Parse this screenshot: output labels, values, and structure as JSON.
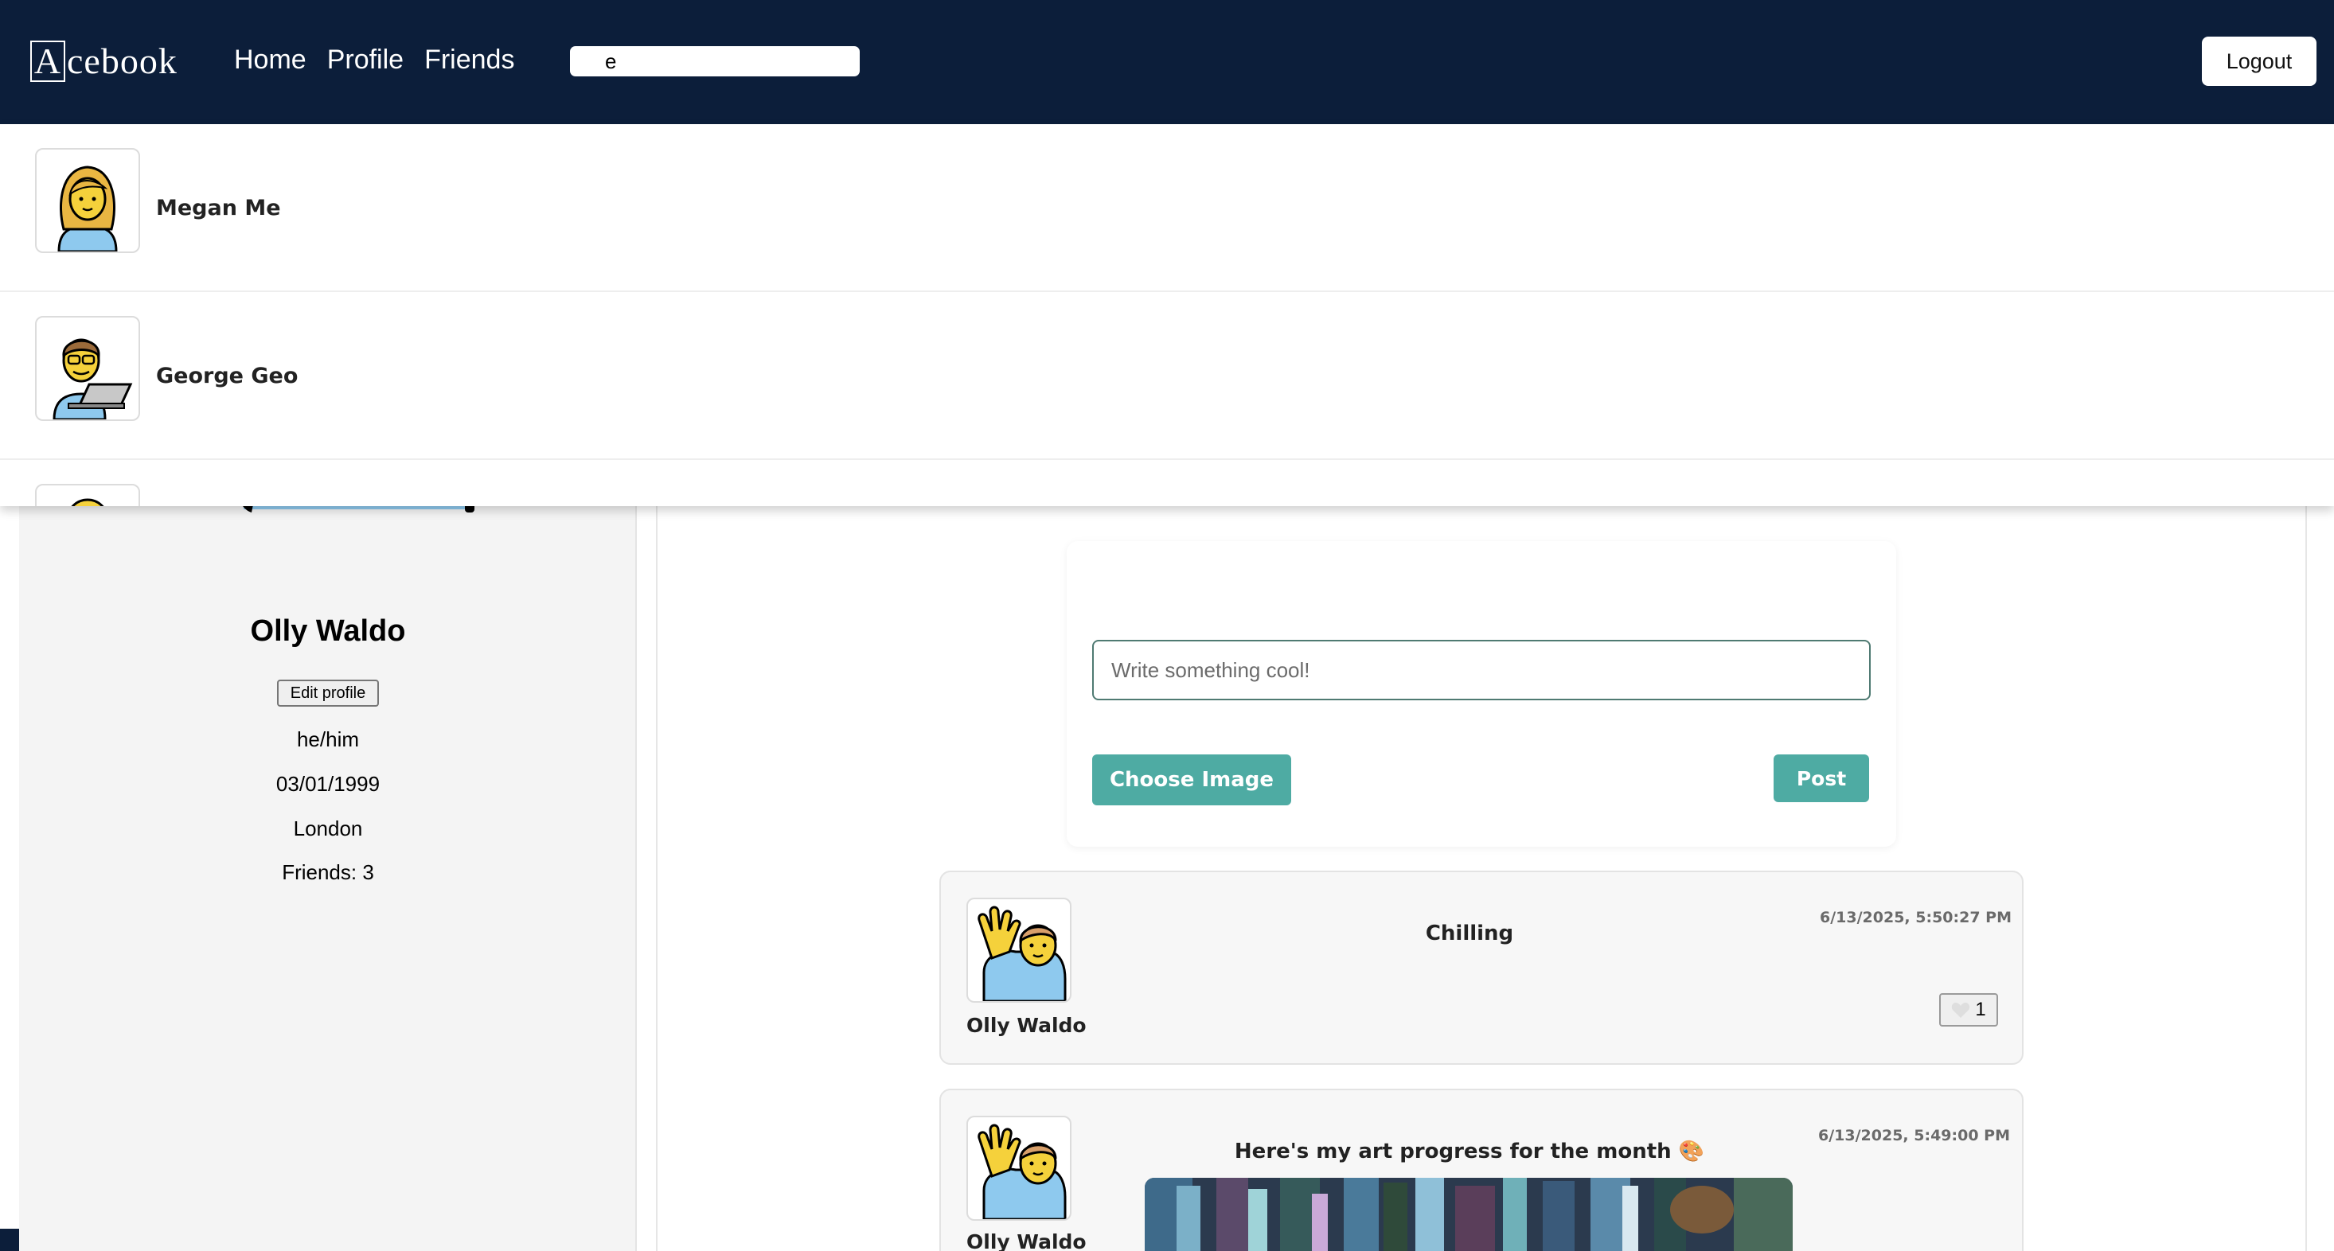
{
  "navbar": {
    "brand_initial": "A",
    "brand_rest": "cebook",
    "links": [
      "Home",
      "Profile",
      "Friends"
    ],
    "search_value": "e",
    "logout_label": "Logout"
  },
  "search_results": [
    {
      "name": "Megan Me",
      "avatar": "woman-avatar-icon"
    },
    {
      "name": "George Geo",
      "avatar": "man-technologist-avatar-icon"
    },
    {
      "name": "",
      "avatar": "partial-avatar-icon"
    }
  ],
  "profile": {
    "name": "Olly Waldo",
    "edit_label": "Edit profile",
    "pronouns": "he/him",
    "dob": "03/01/1999",
    "location": "London",
    "friends": "Friends: 3"
  },
  "composer": {
    "placeholder": "Write something cool!",
    "choose_image_label": "Choose Image",
    "post_label": "Post"
  },
  "posts": [
    {
      "author": "Olly Waldo",
      "text": "Chilling",
      "timestamp": "6/13/2025, 5:50:27 PM",
      "likes": "1",
      "avatar": "person-raising-hand-icon"
    },
    {
      "author": "Olly Waldo",
      "text": "Here's my art progress for the month 🎨",
      "timestamp": "6/13/2025, 5:49:00 PM",
      "likes": "",
      "avatar": "person-raising-hand-icon"
    }
  ],
  "colors": {
    "navbar": "#0c1e3a",
    "accent": "#4eaba3",
    "panel": "#f4f4f4"
  }
}
